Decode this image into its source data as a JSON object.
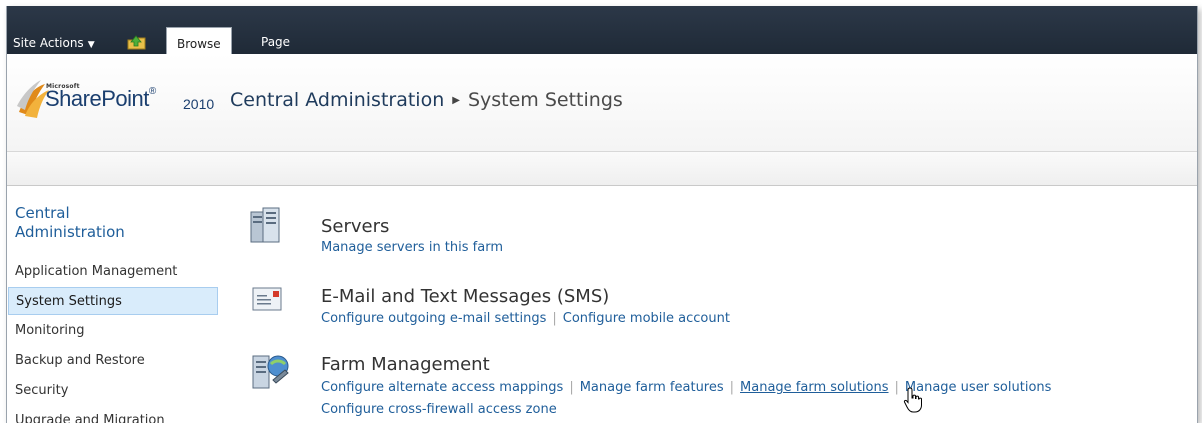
{
  "ribbon": {
    "site_actions": "Site Actions",
    "tabs": [
      {
        "label": "Browse",
        "active": true
      },
      {
        "label": "Page",
        "active": false
      }
    ]
  },
  "header": {
    "logo_small": "Microsoft",
    "logo_word": "SharePoint",
    "logo_tm": "®",
    "logo_year": "2010",
    "breadcrumb": [
      "Central Administration",
      "System Settings"
    ]
  },
  "sidebar": {
    "heading": "Central Administration",
    "items": [
      {
        "label": "Application Management",
        "selected": false
      },
      {
        "label": "System Settings",
        "selected": true
      },
      {
        "label": "Monitoring",
        "selected": false
      },
      {
        "label": "Backup and Restore",
        "selected": false
      },
      {
        "label": "Security",
        "selected": false
      },
      {
        "label": "Upgrade and Migration",
        "selected": false
      }
    ]
  },
  "sections": [
    {
      "title": "Servers",
      "icon": "servers-icon",
      "links": [
        "Manage servers in this farm"
      ]
    },
    {
      "title": "E-Mail and Text Messages (SMS)",
      "icon": "email-icon",
      "links": [
        "Configure outgoing e-mail settings",
        "Configure mobile account"
      ]
    },
    {
      "title": "Farm Management",
      "icon": "farm-management-icon",
      "links": [
        "Configure alternate access mappings",
        "Manage farm features",
        "Manage farm solutions",
        "Manage user solutions"
      ],
      "links_row2": [
        "Configure cross-firewall access zone"
      ],
      "hovered_link": "Manage farm solutions"
    }
  ],
  "colors": {
    "ribbon": "#243040",
    "link": "#1f5e9a",
    "selected_nav": "#d9ecfb"
  }
}
